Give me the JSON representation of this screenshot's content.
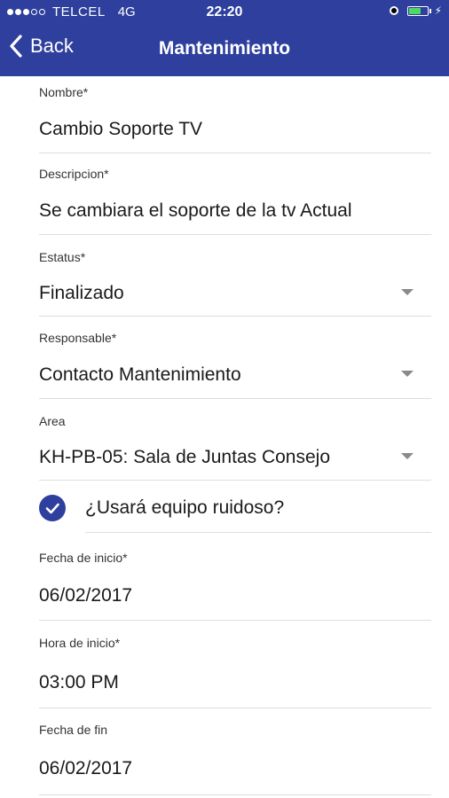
{
  "status_bar": {
    "carrier": "TELCEL",
    "network": "4G",
    "time": "22:20",
    "bolt": "⚡",
    "signal_bars_filled": 3,
    "signal_bars_total": 5,
    "battery_level": 0.7
  },
  "nav": {
    "back_label": "Back",
    "title": "Mantenimiento"
  },
  "form": {
    "nombre": {
      "label": "Nombre*",
      "value": "Cambio Soporte TV"
    },
    "descripcion": {
      "label": "Descripcion*",
      "value": "Se cambiara el soporte de la tv Actual"
    },
    "estatus": {
      "label": "Estatus*",
      "value": "Finalizado"
    },
    "responsable": {
      "label": "Responsable*",
      "value": "Contacto Mantenimiento"
    },
    "area": {
      "label": "Area",
      "value": "KH-PB-05: Sala de Juntas Consejo"
    },
    "ruidoso": {
      "label": "¿Usará equipo ruidoso?",
      "checked": true
    },
    "fecha_inicio": {
      "label": "Fecha de inicio*",
      "value": "06/02/2017"
    },
    "hora_inicio": {
      "label": "Hora de inicio*",
      "value": "03:00 PM"
    },
    "fecha_fin": {
      "label": "Fecha de fin",
      "value": "06/02/2017"
    }
  },
  "colors": {
    "header_bg": "#2e3f9e",
    "accent": "#2e3f9e",
    "battery": "#4cd964"
  }
}
